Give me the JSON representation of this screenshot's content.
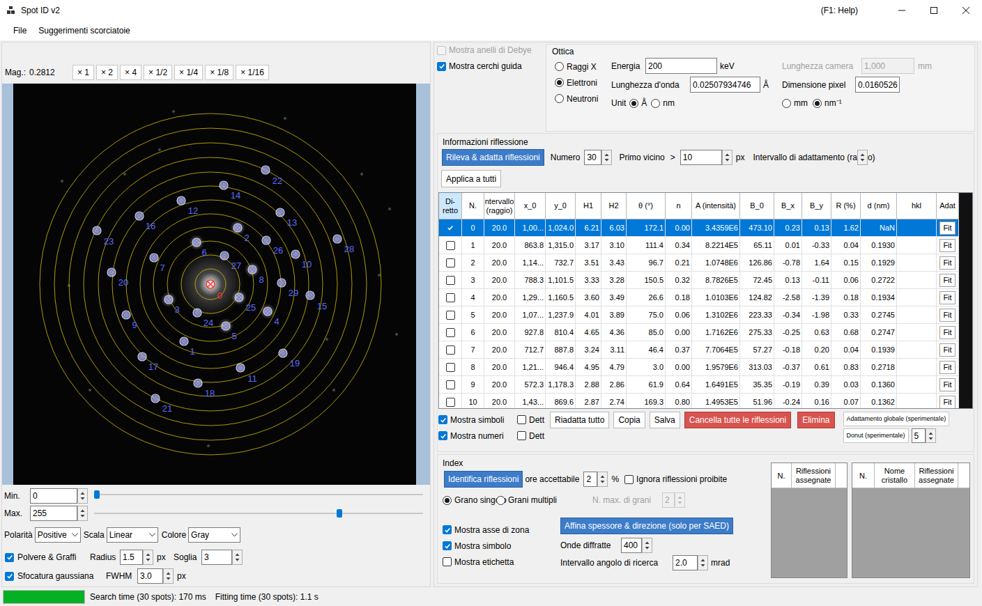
{
  "window": {
    "title": "Spot ID v2",
    "help": "(F1: Help)"
  },
  "menu": [
    {
      "label": "File"
    },
    {
      "label": "Suggerimenti scorciatoie"
    }
  ],
  "viewer": {
    "mag_label": "Mag.:",
    "mag": "0.2812",
    "zoom": [
      "× 1",
      "× 2",
      "× 4",
      "× 1/2",
      "× 1/4",
      "× 1/8",
      "× 1/16"
    ],
    "spots": [
      {
        "label": "0",
        "selected": true
      },
      {
        "label": "1",
        "selected": false
      },
      {
        "label": "2",
        "selected": false
      },
      {
        "label": "3",
        "selected": false
      },
      {
        "label": "4",
        "selected": false
      },
      {
        "label": "5",
        "selected": false
      },
      {
        "label": "6",
        "selected": false
      },
      {
        "label": "7",
        "selected": false
      },
      {
        "label": "8",
        "selected": false
      },
      {
        "label": "9",
        "selected": false
      },
      {
        "label": "10",
        "selected": false
      },
      {
        "label": "11",
        "selected": false
      },
      {
        "label": "12",
        "selected": false
      },
      {
        "label": "13",
        "selected": false
      },
      {
        "label": "14",
        "selected": false
      },
      {
        "label": "15",
        "selected": false
      },
      {
        "label": "16",
        "selected": false
      },
      {
        "label": "17",
        "selected": false
      },
      {
        "label": "18",
        "selected": false
      },
      {
        "label": "19",
        "selected": false
      },
      {
        "label": "20",
        "selected": false
      },
      {
        "label": "21",
        "selected": false
      },
      {
        "label": "22",
        "selected": false
      },
      {
        "label": "23",
        "selected": false
      },
      {
        "label": "24",
        "selected": false
      },
      {
        "label": "25",
        "selected": false
      },
      {
        "label": "26",
        "selected": false
      },
      {
        "label": "27",
        "selected": false
      },
      {
        "label": "28",
        "selected": false
      },
      {
        "label": "29",
        "selected": false
      }
    ]
  },
  "display": {
    "min": {
      "label": "Min.",
      "value": "0",
      "level": 0
    },
    "max": {
      "label": "Max.",
      "value": "255",
      "level": 0.75
    },
    "polarity": {
      "label": "Polarità",
      "value": "Positive"
    },
    "scale": {
      "label": "Scala",
      "value": "Linear"
    },
    "color": {
      "label": "Colore",
      "value": "Gray"
    },
    "dust": {
      "label": "Polvere & Graffi",
      "checked": true,
      "radius_label": "Radius",
      "radius": "1.5",
      "radius_unit": "px",
      "threshold_label": "Soglia",
      "threshold": "3"
    },
    "blur": {
      "label": "Sfocatura gaussiana",
      "checked": true,
      "fwhm_label": "FWHM",
      "fwhm": "3.0",
      "fwhm_unit": "px"
    }
  },
  "status_bar": {
    "level": 1,
    "search": "Search time (30 spots): 170 ms",
    "fitting": "Fitting time (30 spots): 1.1 s"
  },
  "overlay": {
    "debye": {
      "label": "Mostra anelli di Debye",
      "checked": false,
      "disabled": true
    },
    "guides": {
      "label": "Mostra cerchi guida",
      "checked": true
    }
  },
  "optics": {
    "title": "Ottica",
    "radiation": [
      {
        "label": "Raggi X",
        "selected": false
      },
      {
        "label": "Elettroni",
        "selected": true
      },
      {
        "label": "Neutroni",
        "selected": false
      }
    ],
    "energy": {
      "label": "Energia",
      "value": "200",
      "unit": "keV"
    },
    "wavelength": {
      "label": "Lunghezza d'onda",
      "value": "0.02507934746",
      "unit": "Å"
    },
    "unit_label": "Unit",
    "units": [
      {
        "label": "Å",
        "selected": true
      },
      {
        "label": "nm",
        "selected": false
      }
    ],
    "camera": {
      "label": "Lunghezza camera",
      "value": "1,000",
      "unit": "mm",
      "disabled": true
    },
    "pixel": {
      "label": "Dimensione pixel",
      "value": "0.0160526"
    },
    "pixel_units": [
      {
        "label": "mm",
        "selected": false
      },
      {
        "label": "nm⁻¹",
        "selected": true
      }
    ]
  },
  "reflections": {
    "title": "Informazioni riflessione",
    "detect": "Rileva & adatta riflessioni",
    "number_label": "Numero",
    "number": "30",
    "neighbor_label": "Primo vicino",
    "neighbor_op": ">",
    "neighbor": "10",
    "neighbor_unit": "px",
    "range_label": "Intervallo di adattamento (ra",
    "range_tail": "o)",
    "apply": "Applica a tutti",
    "table": {
      "columns": [
        {
          "label": "Di-retto",
          "selected": true
        },
        {
          "label": "N.",
          "selected": false
        },
        {
          "label": "ntervallo (raggio)",
          "selected": false
        },
        {
          "label": "x_0",
          "selected": false
        },
        {
          "label": "y_0",
          "selected": false
        },
        {
          "label": "H1",
          "selected": false
        },
        {
          "label": "H2",
          "selected": false
        },
        {
          "label": "θ (°)",
          "selected": false
        },
        {
          "label": "n",
          "selected": false
        },
        {
          "label": "A (intensità)",
          "selected": false
        },
        {
          "label": "B_0",
          "selected": false
        },
        {
          "label": "B_x",
          "selected": false
        },
        {
          "label": "B_y",
          "selected": false
        },
        {
          "label": "R (%)",
          "selected": false
        },
        {
          "label": "d (nm)",
          "selected": false
        },
        {
          "label": "hkl",
          "selected": false
        },
        {
          "label": "Adat",
          "selected": false
        }
      ],
      "rows": [
        {
          "direct": true,
          "selected": true,
          "cells": [
            "0",
            "20.0",
            "1,00...",
            "1,024.0",
            "6.21",
            "6.03",
            "172.1",
            "0.00",
            "3.4359E6",
            "473.10",
            "0.23",
            "0.13",
            "1.62",
            "NaN"
          ],
          "fit": "Fit"
        },
        {
          "direct": false,
          "selected": false,
          "cells": [
            "1",
            "20.0",
            "863.8",
            "1,315.0",
            "3.17",
            "3.10",
            "111.4",
            "0.34",
            "8.2214E5",
            "65.11",
            "0.01",
            "-0.33",
            "0.04",
            "0.1930"
          ],
          "fit": "Fit"
        },
        {
          "direct": false,
          "selected": false,
          "cells": [
            "2",
            "20.0",
            "1,14...",
            "732.7",
            "3.51",
            "3.43",
            "96.7",
            "0.21",
            "1.0748E6",
            "126.86",
            "-0.78",
            "1.64",
            "0.15",
            "0.1929"
          ],
          "fit": "Fit"
        },
        {
          "direct": false,
          "selected": false,
          "cells": [
            "3",
            "20.0",
            "788.3",
            "1,101.5",
            "3.33",
            "3.28",
            "150.5",
            "0.32",
            "8.7826E5",
            "72.45",
            "0.13",
            "-0.11",
            "0.06",
            "0.2722"
          ],
          "fit": "Fit"
        },
        {
          "direct": false,
          "selected": false,
          "cells": [
            "4",
            "20.0",
            "1,29...",
            "1,160.5",
            "3.60",
            "3.49",
            "26.6",
            "0.18",
            "1.0103E6",
            "124.82",
            "-2.58",
            "-1.39",
            "0.18",
            "0.1934"
          ],
          "fit": "Fit"
        },
        {
          "direct": false,
          "selected": false,
          "cells": [
            "5",
            "20.0",
            "1,07...",
            "1,237.9",
            "4.01",
            "3.89",
            "75.0",
            "0.06",
            "1.3102E6",
            "223.33",
            "-0.34",
            "-1.98",
            "0.33",
            "0.2745"
          ],
          "fit": "Fit"
        },
        {
          "direct": false,
          "selected": false,
          "cells": [
            "6",
            "20.0",
            "927.8",
            "810.4",
            "4.65",
            "4.36",
            "85.0",
            "0.00",
            "1.7162E6",
            "275.33",
            "-0.25",
            "0.63",
            "0.68",
            "0.2747"
          ],
          "fit": "Fit"
        },
        {
          "direct": false,
          "selected": false,
          "cells": [
            "7",
            "20.0",
            "712.7",
            "887.8",
            "3.24",
            "3.11",
            "46.4",
            "0.37",
            "7.7064E5",
            "57.27",
            "-0.18",
            "0.20",
            "0.04",
            "0.1939"
          ],
          "fit": "Fit"
        },
        {
          "direct": false,
          "selected": false,
          "cells": [
            "8",
            "20.0",
            "1,21...",
            "946.4",
            "4.95",
            "4.79",
            "3.0",
            "0.00",
            "1.9579E6",
            "313.03",
            "-0.37",
            "0.61",
            "0.83",
            "0.2718"
          ],
          "fit": "Fit"
        },
        {
          "direct": false,
          "selected": false,
          "cells": [
            "9",
            "20.0",
            "572.3",
            "1,178.3",
            "2.88",
            "2.86",
            "61.9",
            "0.64",
            "1.6491E5",
            "35.35",
            "-0.19",
            "0.39",
            "0.03",
            "0.1360"
          ],
          "fit": "Fit"
        },
        {
          "direct": false,
          "selected": false,
          "cells": [
            "10",
            "20.0",
            "1,43...",
            "869.6",
            "2.87",
            "2.74",
            "169.3",
            "0.80",
            "1.4953E5",
            "51.96",
            "-0.24",
            "0.16",
            "0.07",
            "0.1362"
          ],
          "fit": "Fit"
        }
      ]
    },
    "toggles": [
      {
        "label": "Mostra simboli",
        "checked": true,
        "detail": "Dett",
        "detail_checked": false
      },
      {
        "label": "Mostra numeri",
        "checked": true,
        "detail": "Dett",
        "detail_checked": false
      }
    ],
    "actions": [
      {
        "label": "Riadatta tutto",
        "kind": "normal"
      },
      {
        "label": "Copia",
        "kind": "normal"
      },
      {
        "label": "Salva",
        "kind": "normal"
      },
      {
        "label": "Cancella tutte le riflessioni",
        "kind": "danger"
      },
      {
        "label": "Elimina",
        "kind": "danger"
      }
    ],
    "global_fit": "Adattamento globale (sperimentale)",
    "donut": "Donut (sperimentale)",
    "donut_value": "5"
  },
  "index": {
    "title": "Index",
    "identify": "Identifica riflessioni",
    "tolerance_label": "ore accettabile",
    "tolerance": "2",
    "tolerance_unit": "%",
    "ignore": {
      "label": "Ignora riflessioni proibite",
      "checked": false
    },
    "grains": [
      {
        "label": "Grano singolo",
        "selected": true
      },
      {
        "label": "Grani multipli",
        "selected": false
      }
    ],
    "max_grains": {
      "label": "N. max. di grani",
      "value": "2",
      "disabled": true
    },
    "shows": [
      {
        "label": "Mostra asse di zona",
        "checked": true
      },
      {
        "label": "Mostra simbolo",
        "checked": true
      },
      {
        "label": "Mostra etichetta",
        "checked": false
      }
    ],
    "refine": "Affina spessore & direzione (solo per SAED)",
    "waves": {
      "label": "Onde diffratte",
      "value": "400"
    },
    "search": {
      "label": "Intervallo angolo di ricerca",
      "value": "2.0",
      "unit": "mrad"
    },
    "assigned": {
      "columns": [
        "N.",
        "Riflessioni assegnate"
      ]
    },
    "crystals": {
      "columns": [
        "N.",
        "Nome cristallo",
        "Riflessioni assegnate"
      ]
    }
  }
}
